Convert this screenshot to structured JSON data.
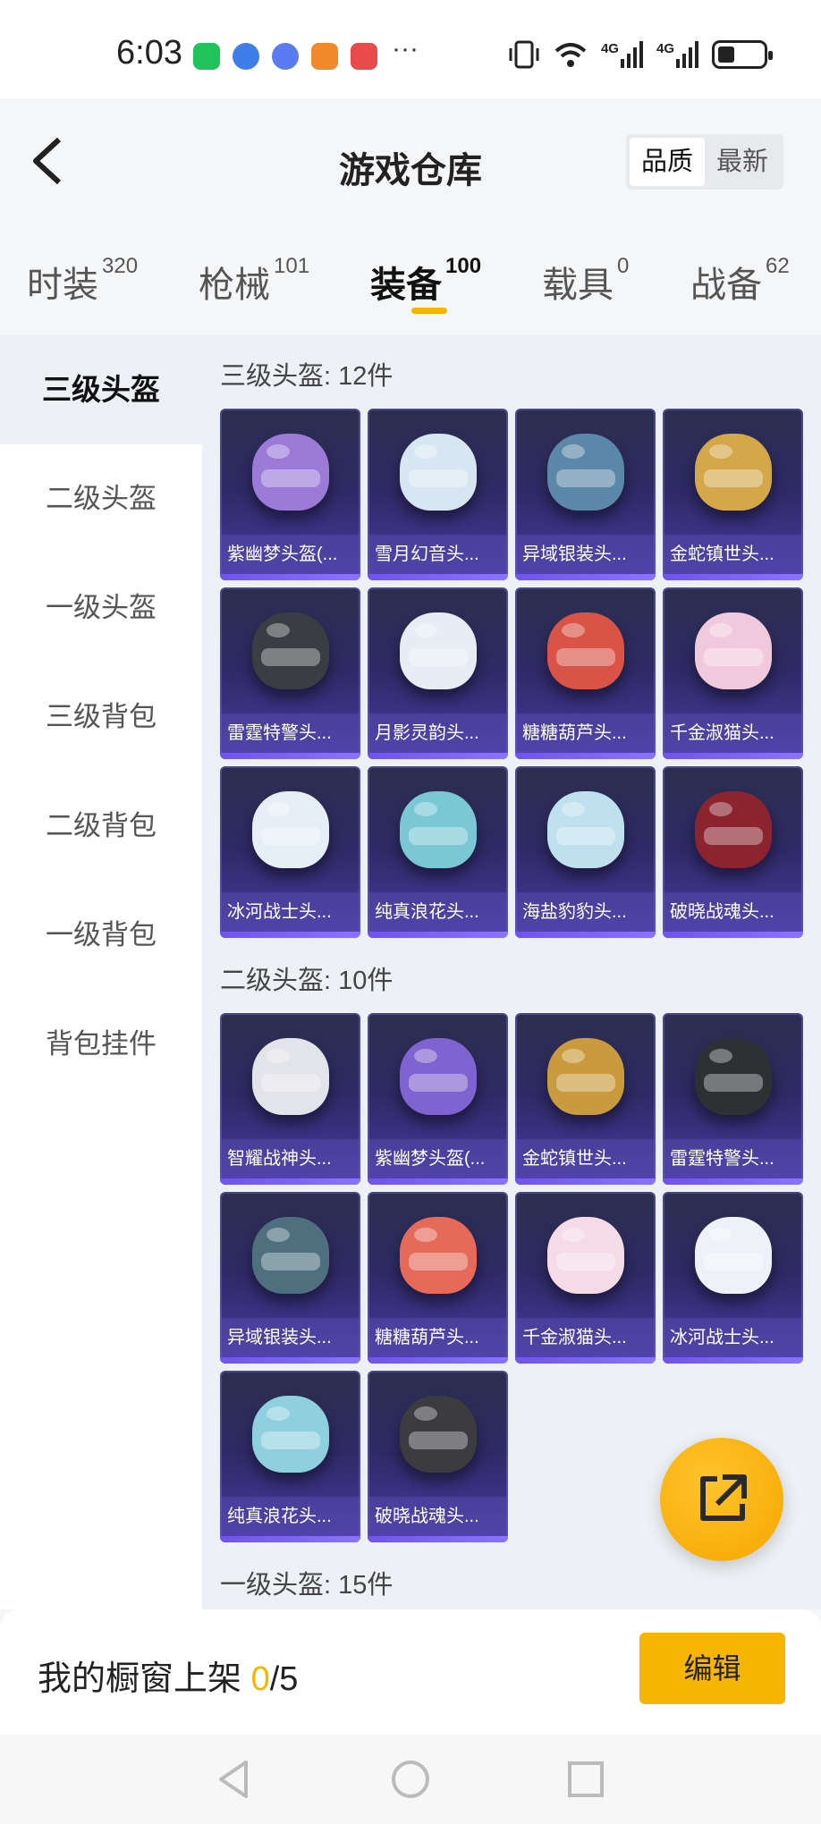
{
  "status_bar": {
    "time": "6:03",
    "more": "···",
    "network_1": "4G",
    "network_2": "4G",
    "app_icons": [
      "wechat-icon",
      "browser-icon",
      "music-icon",
      "video-icon",
      "reader-icon"
    ]
  },
  "header": {
    "title": "游戏仓库",
    "sort_options": [
      "品质",
      "最新"
    ],
    "sort_active": "品质"
  },
  "tabs": [
    {
      "label": "时装",
      "count": "320"
    },
    {
      "label": "枪械",
      "count": "101"
    },
    {
      "label": "装备",
      "count": "100",
      "active": true
    },
    {
      "label": "载具",
      "count": "0"
    },
    {
      "label": "战备",
      "count": "62"
    }
  ],
  "sidebar": {
    "items": [
      "三级头盔",
      "二级头盔",
      "一级头盔",
      "三级背包",
      "二级背包",
      "一级背包",
      "背包挂件"
    ],
    "active": "三级头盔"
  },
  "sections": [
    {
      "title": "三级头盔: 12件",
      "items": [
        {
          "name": "紫幽梦头盔(...",
          "color": "#9b7ad8"
        },
        {
          "name": "雪月幻音头...",
          "color": "#d7e6f2"
        },
        {
          "name": "异域银装头...",
          "color": "#5b88a8"
        },
        {
          "name": "金蛇镇世头...",
          "color": "#d4a84a"
        },
        {
          "name": "雷霆特警头...",
          "color": "#3a3d42"
        },
        {
          "name": "月影灵韵头...",
          "color": "#e8ecf4"
        },
        {
          "name": "糖糖葫芦头...",
          "color": "#d95447"
        },
        {
          "name": "千金淑猫头...",
          "color": "#f1c9dc"
        },
        {
          "name": "冰河战士头...",
          "color": "#e6eef7"
        },
        {
          "name": "纯真浪花头...",
          "color": "#7ac8d6"
        },
        {
          "name": "海盐豹豹头...",
          "color": "#bfe1ef"
        },
        {
          "name": "破晓战魂头...",
          "color": "#8c2430"
        }
      ]
    },
    {
      "title": "二级头盔: 10件",
      "items": [
        {
          "name": "智耀战神头...",
          "color": "#e3e3ea"
        },
        {
          "name": "紫幽梦头盔(...",
          "color": "#7f63d0"
        },
        {
          "name": "金蛇镇世头...",
          "color": "#c99b3e"
        },
        {
          "name": "雷霆特警头...",
          "color": "#2f3034"
        },
        {
          "name": "异域银装头...",
          "color": "#4d6f7e"
        },
        {
          "name": "糖糖葫芦头...",
          "color": "#e56a5a"
        },
        {
          "name": "千金淑猫头...",
          "color": "#f5dbe6"
        },
        {
          "name": "冰河战士头...",
          "color": "#eef2f8"
        },
        {
          "name": "纯真浪花头...",
          "color": "#8fd0df"
        },
        {
          "name": "破晓战魂头...",
          "color": "#3b3b40"
        }
      ]
    },
    {
      "title": "一级头盔: 15件",
      "items": []
    }
  ],
  "bottom_bar": {
    "label": "我的橱窗上架 ",
    "used": "0",
    "total": "/5",
    "edit_label": "编辑"
  },
  "nav": [
    "back-nav-icon",
    "home-nav-icon",
    "recents-nav-icon"
  ],
  "colors": {
    "accent": "#f5b500",
    "card_gradient_top": "#2c2f4f",
    "card_gradient_bottom": "#4a3aa5"
  }
}
